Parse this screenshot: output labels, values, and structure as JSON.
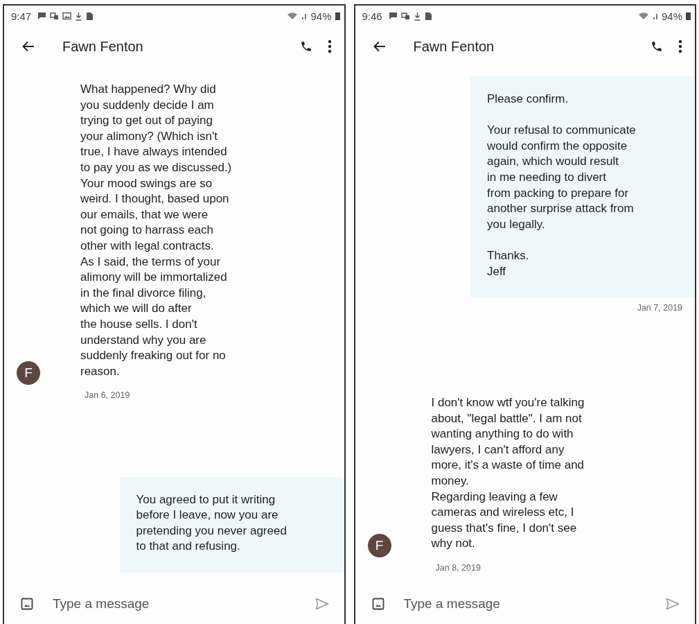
{
  "phones": [
    {
      "status_bar": {
        "time": "9:47",
        "notification_icons": [
          {
            "kind": "chat"
          },
          {
            "kind": "cast"
          },
          {
            "kind": "image"
          },
          {
            "kind": "download"
          },
          {
            "kind": "sim"
          }
        ],
        "battery": "94%"
      },
      "header": {
        "title": "Fawn Fenton"
      },
      "messages": [
        {
          "kind": "received",
          "avatar": "F",
          "text": "What happened? Why did\nyou suddenly decide I am\ntrying to get out of paying\nyour alimony? (Which isn't\ntrue, I have always intended\nto pay you as we discussed.)\nYour mood swings are so\nweird. I thought, based upon\nour emails, that we were\nnot going to harrass each\nother with legal contracts.\nAs I said, the terms of your\nalimony will be immortalized\nin the final divorce filing,\nwhich we will do after\nthe house sells. I don't\nunderstand why you are\nsuddenly freaking out for no\nreason.",
          "date": "Jan 6, 2019"
        },
        {
          "kind": "sent",
          "text": "You agreed to put it writing\nbefore I leave, now you are\npretending you never agreed\nto that and refusing."
        }
      ],
      "composer": {
        "placeholder": "Type a message"
      }
    },
    {
      "status_bar": {
        "time": "9:46",
        "notification_icons": [
          {
            "kind": "chat"
          },
          {
            "kind": "cast"
          },
          {
            "kind": "download"
          },
          {
            "kind": "sim"
          }
        ],
        "battery": "94%"
      },
      "header": {
        "title": "Fawn Fenton"
      },
      "messages": [
        {
          "kind": "sent",
          "text": "Please confirm.\n\nYour refusal to communicate\nwould confirm the opposite\nagain, which would result\nin me needing to divert\nfrom packing to prepare for\nanother surprise attack from\nyou legally.\n\nThanks.\nJeff",
          "date": "Jan 7, 2019"
        },
        {
          "kind": "received",
          "avatar": "F",
          "text": "I don't know wtf you're talking\nabout, \"legal battle\". I am not\nwanting anything to do with\nlawyers, I can't afford any\nmore, it's a waste of time and\nmoney.\nRegarding leaving a few\ncameras and wireless etc, I\nguess that's fine, I don't see\nwhy not.",
          "date": "Jan 8, 2019"
        }
      ],
      "composer": {
        "placeholder": "Type a message"
      }
    }
  ]
}
